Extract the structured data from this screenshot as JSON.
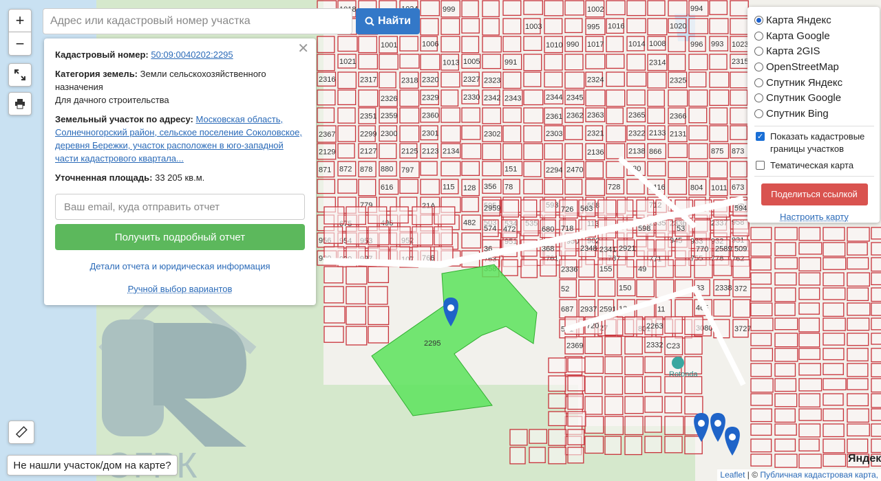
{
  "search": {
    "placeholder": "Адрес или кадастровый номер участка",
    "button_label": "Найти"
  },
  "zoom": {
    "in_label": "+",
    "out_label": "−"
  },
  "info": {
    "cadastral_label": "Кадастровый номер:",
    "cadastral_value": "50:09:0040202:2295",
    "category_label": "Категория земель:",
    "category_value": "Земли сельскохозяйственного назначения",
    "usage": "Для дачного строительства",
    "address_label": "Земельный участок по адресу:",
    "address_value": "Московская область, Солнечногорский район, сельское поселение Соколовское, деревня Бережки, участок расположен в юго-западной части кадастрового квартала...",
    "area_label": "Уточненная площадь:",
    "area_value": "33 205 кв.м.",
    "email_placeholder": "Ваш email, куда отправить отчет",
    "report_button": "Получить подробный отчет",
    "details_link": "Детали отчета и юридическая информация",
    "manual_link": "Ручной выбор вариантов"
  },
  "layers": {
    "options": [
      {
        "label": "Карта Яндекс",
        "selected": true
      },
      {
        "label": "Карта Google",
        "selected": false
      },
      {
        "label": "Карта 2GIS",
        "selected": false
      },
      {
        "label": "OpenStreetMap",
        "selected": false
      },
      {
        "label": "Спутник Яндекс",
        "selected": false
      },
      {
        "label": "Спутник Google",
        "selected": false
      },
      {
        "label": "Спутник Bing",
        "selected": false
      }
    ],
    "show_cadastral": {
      "label": "Показать кадастровые границы участков",
      "checked": true
    },
    "thematic": {
      "label": "Тематическая карта",
      "checked": false
    },
    "share_button": "Поделиться ссылкой",
    "configure_link": "Настроить карту"
  },
  "not_found_button": "Не нашли участок/дом на карте?",
  "attribution": {
    "leaflet": "Leaflet",
    "separator": " | © ",
    "source": "Публичная кадастровая карта,"
  },
  "map": {
    "selected_parcel_label": "2295",
    "parcel_labels": [
      "1018",
      "1024",
      "999",
      "1002",
      "994",
      "998",
      "1022",
      "1019",
      "1000",
      "1003",
      "995",
      "1016",
      "1020",
      "1001",
      "1006",
      "1010",
      "990",
      "1017",
      "1014",
      "1008",
      "996",
      "993",
      "1023",
      "1021",
      "1013",
      "1005",
      "991",
      "2314",
      "2315",
      "2316",
      "2317",
      "2318",
      "2320",
      "2327",
      "2323",
      "2324",
      "2325",
      "2326",
      "2329",
      "2330",
      "2342",
      "2343",
      "2344",
      "2345",
      "2351",
      "2359",
      "2360",
      "2361",
      "2362",
      "2363",
      "2365",
      "2366",
      "2367",
      "2299",
      "2300",
      "2301",
      "2302",
      "2303",
      "2321",
      "2322",
      "2133",
      "2131",
      "2129",
      "2127",
      "2125",
      "2123",
      "2134",
      "2136",
      "2138",
      "866",
      "875",
      "873",
      "871",
      "872",
      "878",
      "880",
      "797",
      "151",
      "2294",
      "2470",
      "530",
      "616",
      "115",
      "128",
      "356",
      "78",
      "728",
      "2116",
      "804",
      "1011",
      "673",
      "779",
      "21A",
      "595",
      "593",
      "558",
      "712",
      "725",
      "675",
      "496",
      "482",
      "503",
      "534",
      "535",
      "113",
      "2335",
      "2336",
      "2337",
      "958",
      "956",
      "954",
      "953",
      "952",
      "951",
      "950",
      "962",
      "945",
      "933",
      "932",
      "931",
      "930",
      "929",
      "927",
      "107",
      "766",
      "763",
      "761",
      "787",
      "771",
      "755",
      "778",
      "762",
      "2959",
      "726",
      "563",
      "594",
      "574",
      "472",
      "680",
      "718",
      "598",
      "53",
      "36",
      "368",
      "2348",
      "2341",
      "2921",
      "770",
      "2589",
      "509",
      "358",
      "2336",
      "155",
      "49",
      "52",
      "150",
      "83",
      "2338",
      "372",
      "687",
      "2937",
      "2591",
      "13",
      "11",
      "465",
      "581",
      "27",
      "801",
      "3080",
      "3727",
      "720",
      "2263",
      "2369",
      "2332",
      "C23"
    ],
    "label_place": "Rotonda",
    "label_yandex": "Яндекс",
    "label_tile": "ОГРК"
  },
  "icons": {
    "search": "search-icon",
    "fullscreen": "expand-icon",
    "print": "printer-icon",
    "ruler": "ruler-icon",
    "close": "close-icon",
    "pin": "map-pin-icon"
  },
  "colors": {
    "parcel_border": "#c8323a",
    "selected_parcel": "#5ce35c",
    "forest": "#cfe5c6",
    "water": "#cfe3f5",
    "accent_blue": "#3378c8",
    "report_green": "#5cb85c",
    "share_red": "#d9534f"
  }
}
